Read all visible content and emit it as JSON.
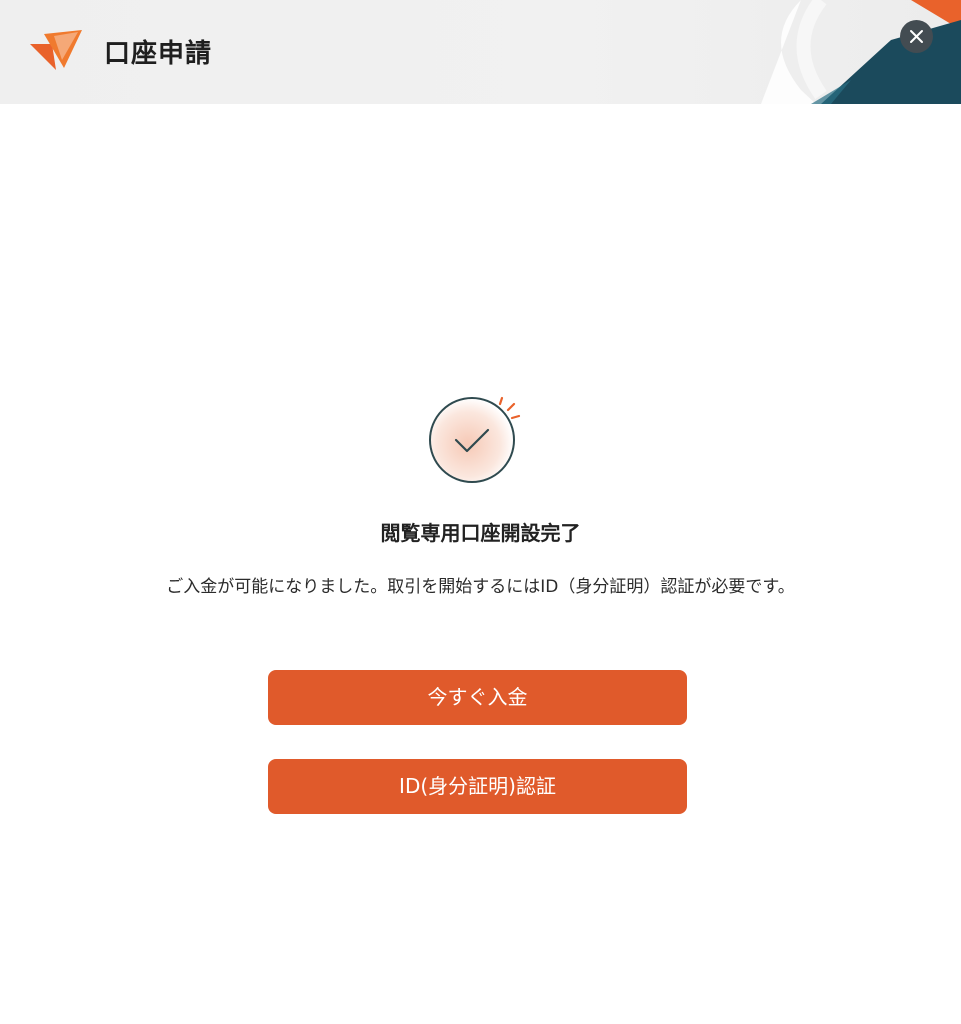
{
  "header": {
    "title": "口座申請",
    "logo_icon": "orange-paper-plane-logo",
    "close_icon": "close-icon",
    "close_label": "×"
  },
  "colors": {
    "accent": "#e05a2b",
    "close_bg": "#434c52",
    "header_bg": "#efefef",
    "deco_teal": "#1b4a5c",
    "check_ring": "#2f4a4f"
  },
  "main": {
    "status_icon": "check-circle-icon",
    "headline": "閲覧専用口座開設完了",
    "message": "ご入金が可能になりました。取引を開始するにはID（身分証明）認証が必要です。",
    "buttons": {
      "deposit_now": "今すぐ入金",
      "id_verification": "ID(身分証明)認証"
    }
  }
}
